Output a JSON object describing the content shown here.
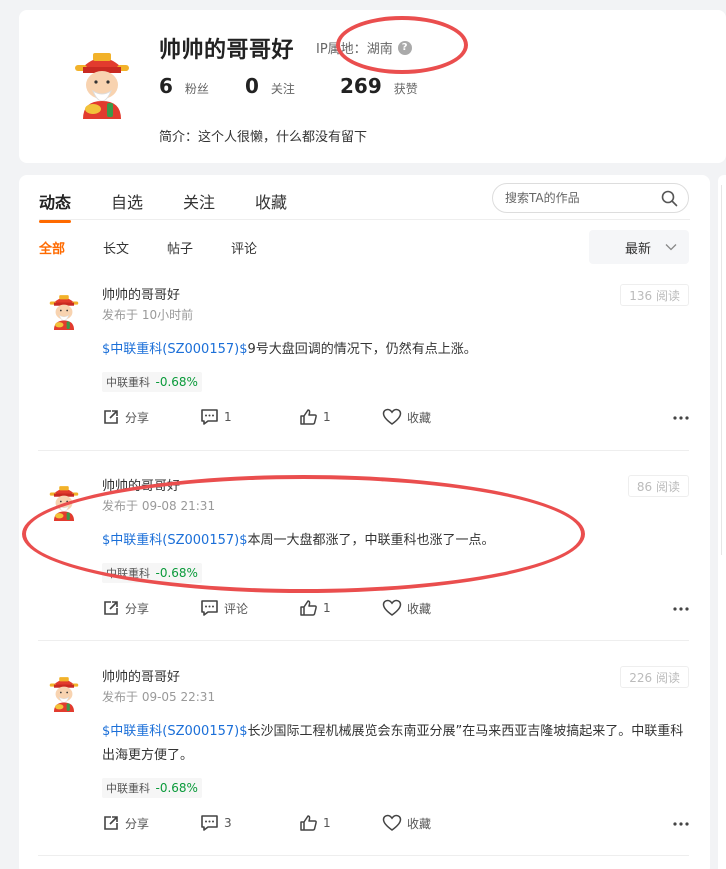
{
  "profile": {
    "name": "帅帅的哥哥好",
    "ip_label": "IP属地：",
    "ip_value": "湖南",
    "followers_count": "6",
    "followers_label": "粉丝",
    "following_count": "0",
    "following_label": "关注",
    "likes_count": "269",
    "likes_label": "获赞",
    "bio": "简介：这个人很懒，什么都没有留下"
  },
  "main_tabs": [
    {
      "label": "动态"
    },
    {
      "label": "自选"
    },
    {
      "label": "关注"
    },
    {
      "label": "收藏"
    }
  ],
  "search": {
    "placeholder": "搜索TA的作品"
  },
  "sub_tabs": [
    {
      "label": "全部"
    },
    {
      "label": "长文"
    },
    {
      "label": "帖子"
    },
    {
      "label": "评论"
    }
  ],
  "sort": {
    "selected": "最新"
  },
  "posts": [
    {
      "author": "帅帅的哥哥好",
      "time": "发布于 10小时前",
      "reads": "136 阅读",
      "stock_link": "$中联重科(SZ000157)$",
      "text": "9号大盘回调的情况下，仍然有点上涨。",
      "tag_name": "中联重科",
      "tag_change": "-0.68%",
      "share_label": "分享",
      "comment_label": "1",
      "like_label": "1",
      "favorite_label": "收藏"
    },
    {
      "author": "帅帅的哥哥好",
      "time": "发布于 09-08 21:31",
      "reads": "86 阅读",
      "stock_link": "$中联重科(SZ000157)$",
      "text": "本周一大盘都涨了，中联重科也涨了一点。",
      "tag_name": "中联重科",
      "tag_change": "-0.68%",
      "share_label": "分享",
      "comment_label": "评论",
      "like_label": "1",
      "favorite_label": "收藏"
    },
    {
      "author": "帅帅的哥哥好",
      "time": "发布于 09-05 22:31",
      "reads": "226 阅读",
      "stock_link": "$中联重科(SZ000157)$",
      "text": "长沙国际工程机械展览会东南亚分展”在马来西亚吉隆坡搞起来了。中联重科出海更方便了。",
      "tag_name": "中联重科",
      "tag_change": "-0.68%",
      "share_label": "分享",
      "comment_label": "3",
      "like_label": "1",
      "favorite_label": "收藏"
    }
  ],
  "colors": {
    "accent": "#ff6a00",
    "link": "#1b6fd8",
    "change_green": "#0a9a3a",
    "annotation_red": "#ea4e4e"
  }
}
